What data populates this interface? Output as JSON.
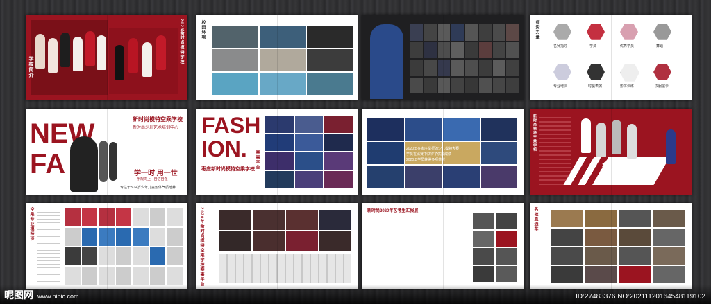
{
  "spreads": {
    "s1": {
      "side_title": "2023新时尚模特学校",
      "side_label": "学校简介"
    },
    "s2": {
      "title": "校园环境"
    },
    "s3": {
      "title": ""
    },
    "s4": {
      "title": "师资力量",
      "hex_labels": [
        "名师指导",
        "学员",
        "优秀学员",
        "舞蹈",
        "专业培训",
        "时装表演",
        "形体训练",
        "汉服展示"
      ]
    },
    "s5": {
      "title_new": "NEW",
      "title_fa": "FA",
      "school_name": "新时尚模特空乘学校",
      "school_sub": "新时尚少儿艺术培训中心",
      "slogan_main": "学一时 用一世",
      "slogan_sub": "乐观向上 · 自信自强",
      "footer": "专注于3-14岁少年儿童形体气质培养"
    },
    "s6": {
      "fash": "FASH",
      "ion": "ION.",
      "school": "枣庄新时尚模特空乘学校",
      "platform": "赛事平台"
    },
    "s7": {
      "notes": [
        "2020年在枣庄举行的少儿模特大赛",
        "学员在比赛中获得了优异成绩",
        "2020年学员获得多项荣誉"
      ]
    },
    "s8": {
      "tag": "新时尚",
      "side_text": "新时尚模特空乘学校"
    },
    "s9": {
      "side_title": "空乘专业模特班"
    },
    "s10": {
      "side_title": "2020年新时尚模特空乘学校赛事平台"
    },
    "s11": {
      "title": "新时尚2020年艺考生汇报展"
    },
    "s12": {
      "title": "名校直通车"
    }
  },
  "watermark": {
    "logo": "昵图网",
    "url": "www.nipic.com",
    "id": "ID:27483376 NO:20211120164548119102"
  },
  "colors": {
    "brand_red": "#9b1420",
    "page_white": "#ffffff",
    "background": "#2f2f31"
  }
}
